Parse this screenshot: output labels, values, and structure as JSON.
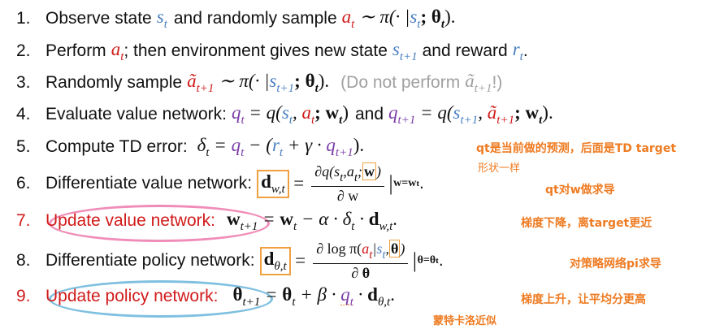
{
  "steps": [
    {
      "num": "1.",
      "text": "Observe state",
      "m1": "s",
      "s1": "t",
      "text2": "and randomly sample",
      "m2": "a",
      "s2": "t",
      "math": "∼ π(· |",
      "m3": "s",
      "s3": "t",
      "math2": "; θ",
      "s4": "t",
      "end": ")."
    },
    {
      "num": "2.",
      "text": "Perform",
      "m1": "a",
      "s1": "t",
      "text2": "; then environment gives new state",
      "m2": "s",
      "s2": "t+1",
      "text3": "and reward",
      "m3": "r",
      "s3": "t",
      "end": "."
    },
    {
      "num": "3.",
      "text": "Randomly sample",
      "m1": "ã",
      "s1": "t+1",
      "math": "∼ π(· |",
      "m2": "s",
      "s2": "t+1",
      "math2": "; θ",
      "s3": "t",
      "end": ").",
      "gray": "(Do not perform",
      "gm": "ã",
      "gs": "t+1",
      "gend": "!)"
    },
    {
      "num": "4.",
      "text": "Evaluate value network:",
      "m1": "q",
      "s1": "t",
      "eq1": "= q(",
      "m2": "s",
      "s2": "t",
      "comma": ",",
      "m3": "a",
      "s3": "t",
      "w1": "; w",
      "ws1": "t",
      "close1": ")",
      "and": "and",
      "m4": "q",
      "s4": "t+1",
      "eq2": "= q(",
      "m5": "s",
      "s5": "t+1",
      "comma2": ",",
      "m6": "ã",
      "s6": "t+1",
      "w2": "; w",
      "ws2": "t",
      "close2": ")."
    },
    {
      "num": "5.",
      "text": "Compute TD error:",
      "delta": "δ",
      "ds": "t",
      "eq": "=",
      "m1": "q",
      "s1": "t",
      "minus": "− (",
      "m2": "r",
      "s2": "t",
      "plus": "+ γ ·",
      "m3": "q",
      "s3": "t+1",
      "end": ")."
    },
    {
      "num": "6.",
      "text": "Differentiate value network:",
      "dvar": "d",
      "dsub": "w,t",
      "eq": "=",
      "frac_top": "∂q(s",
      "frac_top_sub": "t",
      "frac_top2": ",a",
      "frac_top_sub2": "t",
      "frac_top3": ";",
      "frac_top_w": "w",
      "frac_top_end": ")",
      "frac_bot": "∂ w",
      "eval": "|",
      "eval_sub": "w=w",
      "eval_sub2": "t",
      "end": "."
    },
    {
      "num": "7.",
      "text": "Update value network:",
      "lhs": "w",
      "lhs_sub": "t+1",
      "eq": "=",
      "r1": "w",
      "r1s": "t",
      "mid": "− α ·",
      "delta": "δ",
      "ds": "t",
      "dot": "·",
      "dvar": "d",
      "dsub": "w,t",
      "end": "."
    },
    {
      "num": "8.",
      "text": "Differentiate policy network:",
      "dvar": "d",
      "dsub": "θ,t",
      "eq": "=",
      "frac_top": "∂ log π(",
      "frac_top_a": "a",
      "frac_top_as": "t",
      "frac_top_bar": "|",
      "frac_top_s": "s",
      "frac_top_ss": "t",
      "frac_top_semi": ",",
      "frac_top_theta": "θ",
      "frac_top_end": ")",
      "frac_bot": "∂ θ",
      "eval": "|",
      "eval_sub": "θ=θ",
      "eval_sub2": "t",
      "end": "."
    },
    {
      "num": "9.",
      "text": "Update policy network:",
      "lhs": "θ",
      "lhs_sub": "t+1",
      "eq": "=",
      "r1": "θ",
      "r1s": "t",
      "mid": "+ β ·",
      "m1": "q",
      "s1": "t",
      "dot": "·",
      "dvar": "d",
      "dsub": "θ,t",
      "end": "."
    }
  ],
  "annotations": {
    "a5": "qt是当前做的预测，后面是TD target",
    "a6_shape": "形状一样",
    "a6": "qt对w做求导",
    "a7": "梯度下降，离target更近",
    "a8": "对策略网络pi求导",
    "a9": "梯度上升，让平均分更高",
    "a9_below": "蒙特卡洛近似"
  },
  "colors": {
    "orange": "#d96a16",
    "blue": "#4a7fc1",
    "red": "#d11b1b",
    "purple": "#7b3ea8",
    "annotation": "#ee7b22",
    "pink_ellipse": "#f08cb8",
    "blue_ellipse": "#7fc0e0"
  }
}
